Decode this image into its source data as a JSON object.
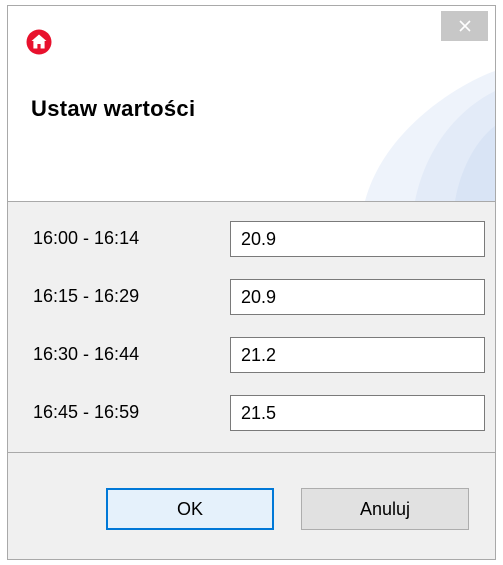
{
  "window": {
    "close_glyph": "✕",
    "app_icon": "home-icon",
    "accent_color": "#e8112d"
  },
  "header": {
    "title": "Ustaw wartości"
  },
  "rows": [
    {
      "label": "16:00 - 16:14",
      "value": "20.9"
    },
    {
      "label": "16:15 - 16:29",
      "value": "20.9"
    },
    {
      "label": "16:30 - 16:44",
      "value": "21.2"
    },
    {
      "label": "16:45 - 16:59",
      "value": "21.5"
    }
  ],
  "buttons": {
    "ok_label": "OK",
    "cancel_label": "Anuluj"
  }
}
